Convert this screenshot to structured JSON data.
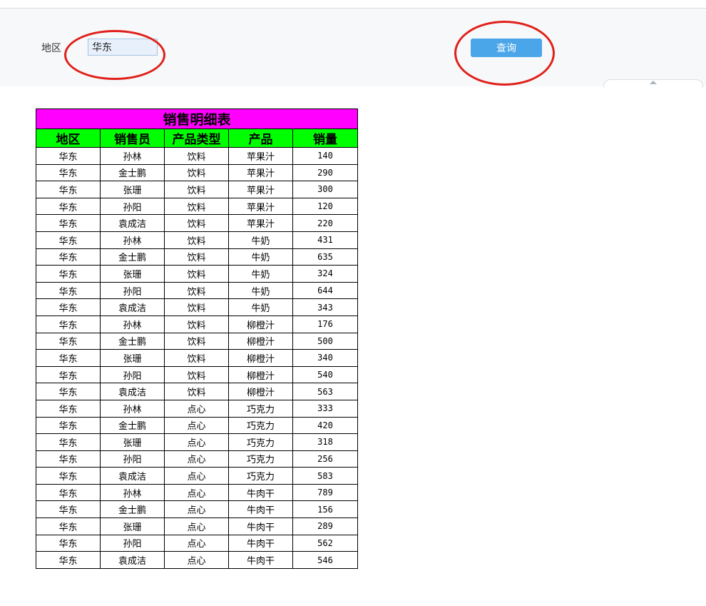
{
  "filter": {
    "region_label": "地区",
    "region_value": "华东",
    "query_label": "查询"
  },
  "colors": {
    "title_bg": "#ff00ff",
    "header_bg": "#00ff00",
    "button_bg": "#4aa6e8",
    "annotation": "#e0201a"
  },
  "report": {
    "title": "销售明细表",
    "columns": [
      "地区",
      "销售员",
      "产品类型",
      "产品",
      "销量"
    ],
    "rows": [
      [
        "华东",
        "孙林",
        "饮料",
        "苹果汁",
        "140"
      ],
      [
        "华东",
        "金士鹏",
        "饮料",
        "苹果汁",
        "290"
      ],
      [
        "华东",
        "张珊",
        "饮料",
        "苹果汁",
        "300"
      ],
      [
        "华东",
        "孙阳",
        "饮料",
        "苹果汁",
        "120"
      ],
      [
        "华东",
        "袁成洁",
        "饮料",
        "苹果汁",
        "220"
      ],
      [
        "华东",
        "孙林",
        "饮料",
        "牛奶",
        "431"
      ],
      [
        "华东",
        "金士鹏",
        "饮料",
        "牛奶",
        "635"
      ],
      [
        "华东",
        "张珊",
        "饮料",
        "牛奶",
        "324"
      ],
      [
        "华东",
        "孙阳",
        "饮料",
        "牛奶",
        "644"
      ],
      [
        "华东",
        "袁成洁",
        "饮料",
        "牛奶",
        "343"
      ],
      [
        "华东",
        "孙林",
        "饮料",
        "柳橙汁",
        "176"
      ],
      [
        "华东",
        "金士鹏",
        "饮料",
        "柳橙汁",
        "500"
      ],
      [
        "华东",
        "张珊",
        "饮料",
        "柳橙汁",
        "340"
      ],
      [
        "华东",
        "孙阳",
        "饮料",
        "柳橙汁",
        "540"
      ],
      [
        "华东",
        "袁成洁",
        "饮料",
        "柳橙汁",
        "563"
      ],
      [
        "华东",
        "孙林",
        "点心",
        "巧克力",
        "333"
      ],
      [
        "华东",
        "金士鹏",
        "点心",
        "巧克力",
        "420"
      ],
      [
        "华东",
        "张珊",
        "点心",
        "巧克力",
        "318"
      ],
      [
        "华东",
        "孙阳",
        "点心",
        "巧克力",
        "256"
      ],
      [
        "华东",
        "袁成洁",
        "点心",
        "巧克力",
        "583"
      ],
      [
        "华东",
        "孙林",
        "点心",
        "牛肉干",
        "789"
      ],
      [
        "华东",
        "金士鹏",
        "点心",
        "牛肉干",
        "156"
      ],
      [
        "华东",
        "张珊",
        "点心",
        "牛肉干",
        "289"
      ],
      [
        "华东",
        "孙阳",
        "点心",
        "牛肉干",
        "562"
      ],
      [
        "华东",
        "袁成洁",
        "点心",
        "牛肉干",
        "546"
      ]
    ]
  }
}
